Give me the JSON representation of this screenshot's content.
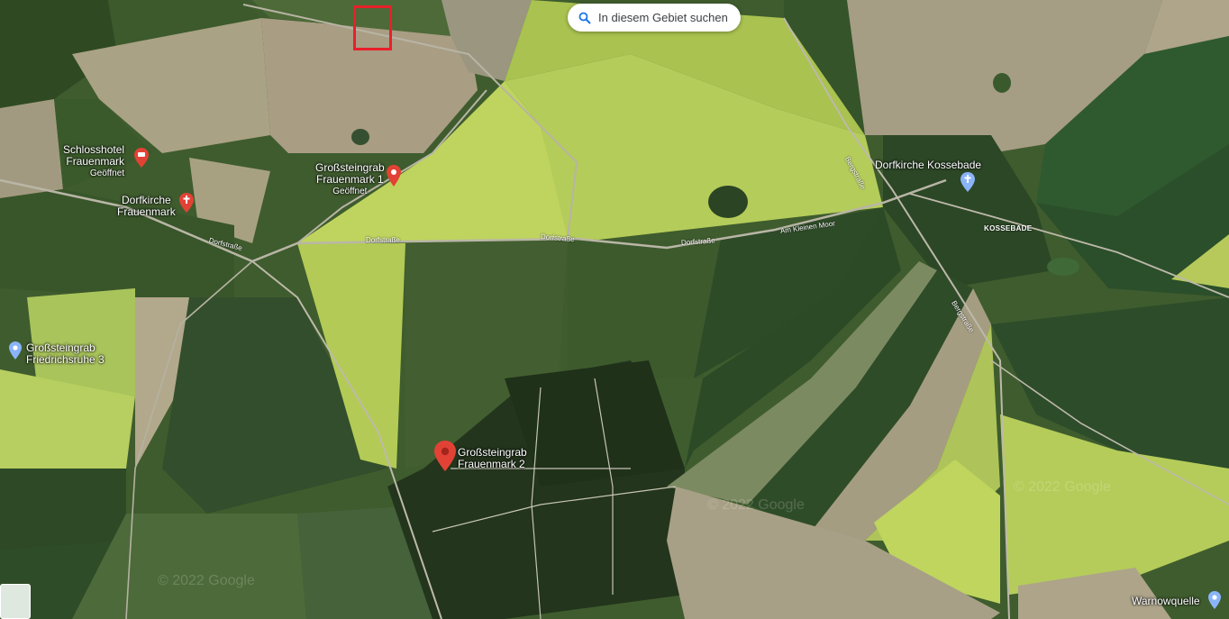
{
  "search": {
    "label": "In diesem Gebiet suchen",
    "icon": "search-icon"
  },
  "places": [
    {
      "id": "schlosshotel",
      "name_line1": "Schlosshotel",
      "name_line2": "Frauenmark",
      "status": "Geöffnet",
      "icon": "hotel-icon",
      "color": "#e24235"
    },
    {
      "id": "dorfkirche-frauenmark",
      "name_line1": "Dorfkirche",
      "name_line2": "Frauenmark",
      "icon": "church-icon",
      "color": "#e24235"
    },
    {
      "id": "grab1",
      "name_line1": "Großsteingrab",
      "name_line2": "Frauenmark 1",
      "status": "Geöffnet",
      "icon": "map-pin-icon",
      "color": "#e24235"
    },
    {
      "id": "grab2",
      "name_line1": "Großsteingrab",
      "name_line2": "Frauenmark 2",
      "icon": "map-pin-icon",
      "color": "#e24235"
    },
    {
      "id": "grab3",
      "name_line1": "Großsteingrab",
      "name_line2": "Friedrichsruhe 3",
      "icon": "map-pin-icon",
      "color": "#8ab4f8"
    },
    {
      "id": "kossebade-kirche",
      "name_line1": "Dorfkirche Kossebade",
      "icon": "church-icon",
      "color": "#8ab4f8"
    },
    {
      "id": "warnowquelle",
      "name_line1": "Warnowquelle",
      "icon": "map-pin-icon",
      "color": "#8ab4f8"
    }
  ],
  "roads": {
    "dorfstrasse_1": "Dorfstraße",
    "dorfstrasse_2": "Dorfstraße",
    "dorfstrasse_3": "Dorfstraße",
    "dorfstrasse_4": "Dorfstraße",
    "am_kleinen_moor": "Am Kleinen Moor",
    "bergstrasse_1": "Bergstraße",
    "bergstrasse_2": "Bergstraße"
  },
  "localities": {
    "kossebade": "KOSSEBADE"
  },
  "watermark": "© 2022 Google",
  "colors": {
    "highlight": "#e8202a",
    "pin_red": "#e24235",
    "pin_blue": "#8ab4f8"
  }
}
